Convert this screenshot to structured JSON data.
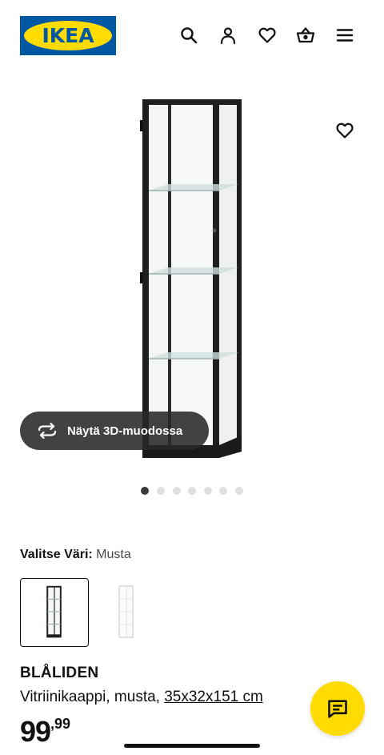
{
  "header": {
    "logo_text": "IKEA",
    "icons": [
      "search-icon",
      "account-icon",
      "favourites-heart-icon",
      "cart-basket-icon",
      "menu-hamburger-icon"
    ]
  },
  "gallery": {
    "view_3d_label": "Näytä 3D-muodossa",
    "total_images": 7,
    "active_image": 1
  },
  "variant": {
    "label": "Valitse Väri:",
    "value": "Musta",
    "options": [
      "black",
      "white"
    ],
    "selected": "black"
  },
  "product": {
    "name": "BLÅLIDEN",
    "description": "Vitriinikaappi, musta,",
    "size": "35x32x151 cm",
    "price_integer": "99",
    "price_decimal": ",99"
  },
  "colors": {
    "ikea_blue": "#0058a3",
    "ikea_yellow": "#ffdb00"
  }
}
